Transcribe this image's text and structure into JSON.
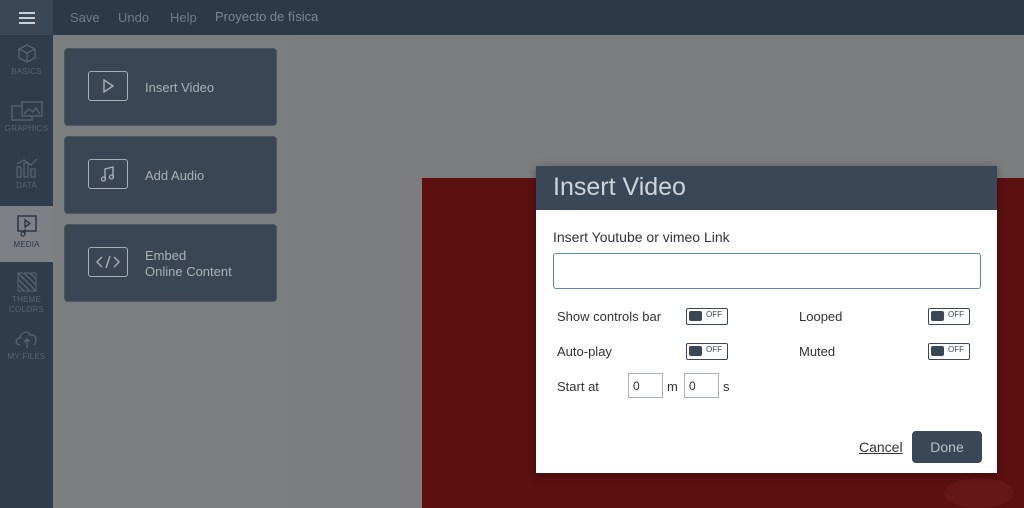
{
  "topbar": {
    "menu_icon": "hamburger-icon",
    "save": "Save",
    "undo": "Undo",
    "help": "Help",
    "project_title": "Proyecto de física"
  },
  "rail": {
    "items": [
      {
        "label": "BASICS",
        "icon": "cube-icon"
      },
      {
        "label": "GRAPHICS",
        "icon": "image-icon"
      },
      {
        "label": "DATA",
        "icon": "chart-icon"
      },
      {
        "label": "MEDIA",
        "icon": "media-icon"
      },
      {
        "label": "THEME\nCOLORS",
        "icon": "pattern-icon"
      },
      {
        "label": "MY FILES",
        "icon": "cloud-upload-icon"
      }
    ]
  },
  "panel": {
    "cards": [
      {
        "label": "Insert Video",
        "icon": "play-icon"
      },
      {
        "label": "Add Audio",
        "icon": "music-note-icon"
      },
      {
        "label_line1": "Embed",
        "label_line2": "Online Content",
        "icon": "code-icon"
      }
    ]
  },
  "dialog": {
    "title": "Insert Video",
    "link_label": "Insert Youtube or vimeo Link",
    "link_value": "",
    "options": {
      "show_controls": {
        "label": "Show controls bar",
        "state": "OFF"
      },
      "looped": {
        "label": "Looped",
        "state": "OFF"
      },
      "autoplay": {
        "label": "Auto-play",
        "state": "OFF"
      },
      "muted": {
        "label": "Muted",
        "state": "OFF"
      }
    },
    "start_at": {
      "label": "Start at",
      "minutes": "0",
      "minutes_unit": "m",
      "seconds": "0",
      "seconds_unit": "s"
    },
    "cancel": "Cancel",
    "done": "Done"
  },
  "colors": {
    "dark": "#2b3949",
    "accent": "#3a4756",
    "slide": "#5c1010"
  }
}
